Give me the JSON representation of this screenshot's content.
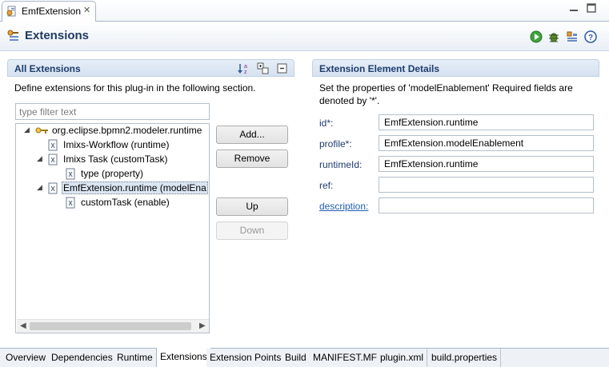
{
  "editor_tab": {
    "title": "EmfExtension",
    "close_glyph": "✕"
  },
  "header": {
    "title": "Extensions"
  },
  "left_section": {
    "title": "All Extensions",
    "description": "Define extensions for this plug-in in the following section.",
    "filter_placeholder": "type filter text",
    "tree": [
      {
        "label": "org.eclipse.bpmn2.modeler.runtime",
        "icon": "extension-point-icon",
        "expanded": true
      },
      {
        "label": "Imixs-Workflow (runtime)",
        "icon": "xml-element-icon"
      },
      {
        "label": "Imixs Task (customTask)",
        "icon": "xml-element-icon",
        "expanded": true
      },
      {
        "label": "type (property)",
        "icon": "xml-element-icon"
      },
      {
        "label": "EmfExtension.runtime (modelEna",
        "icon": "xml-element-icon",
        "expanded": true,
        "selected": true
      },
      {
        "label": "customTask (enable)",
        "icon": "xml-element-icon"
      }
    ],
    "buttons": {
      "add": "Add...",
      "remove": "Remove",
      "up": "Up",
      "down": "Down"
    }
  },
  "right_section": {
    "title": "Extension Element Details",
    "description_line1": "Set the properties of 'modelEnablement' Required fields are",
    "description_line2": "denoted by '*'.",
    "fields": {
      "id": {
        "label": "id*:",
        "value": "EmfExtension.runtime"
      },
      "profile": {
        "label": "profile*:",
        "value": "EmfExtension.modelEnablement"
      },
      "runtime_id": {
        "label": "runtimeId:",
        "value": "EmfExtension.runtime"
      },
      "ref": {
        "label": "ref:",
        "value": ""
      },
      "description": {
        "label": "description:",
        "value": ""
      }
    }
  },
  "page_tabs": [
    "Overview",
    "Dependencies",
    "Runtime",
    "Extensions",
    "Extension Points",
    "Build",
    "MANIFEST.MF",
    "plugin.xml",
    "build.properties"
  ],
  "active_page_tab": "Extensions",
  "colors": {
    "section_title": "#1e3c6e",
    "link": "#1f5fb0",
    "selection": "#dbe6f3"
  }
}
